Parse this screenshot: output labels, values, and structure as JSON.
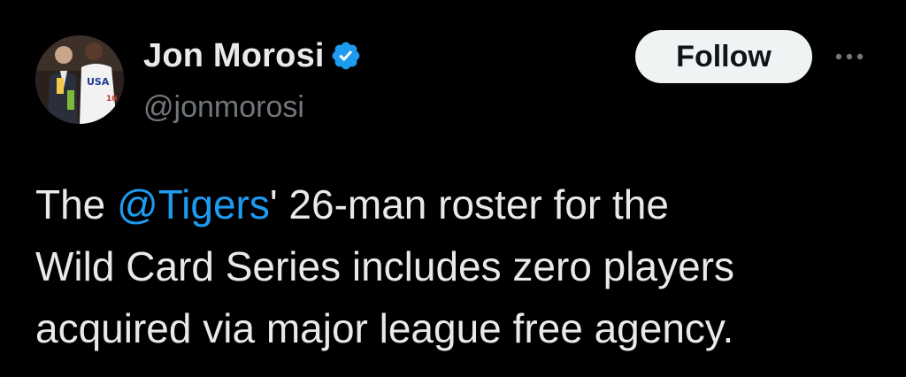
{
  "author": {
    "display_name": "Jon Morosi",
    "handle": "@jonmorosi",
    "verified": true,
    "avatar_jersey_text": "USA",
    "avatar_jersey_number": "10"
  },
  "actions": {
    "follow_label": "Follow",
    "more_icon": "more-horizontal-icon"
  },
  "tweet": {
    "line1_before": "The ",
    "line1_mention": "@Tigers",
    "line1_after": "' 26-man roster for the",
    "line2": "Wild Card Series includes zero players",
    "line3": "acquired via major league free agency."
  },
  "colors": {
    "background": "#000000",
    "text_primary": "#e7e9ea",
    "text_secondary": "#71767b",
    "link": "#1d9bf0",
    "verified_badge": "#1d9bf0",
    "follow_button_bg": "#eff3f4",
    "follow_button_text": "#0f1419"
  }
}
